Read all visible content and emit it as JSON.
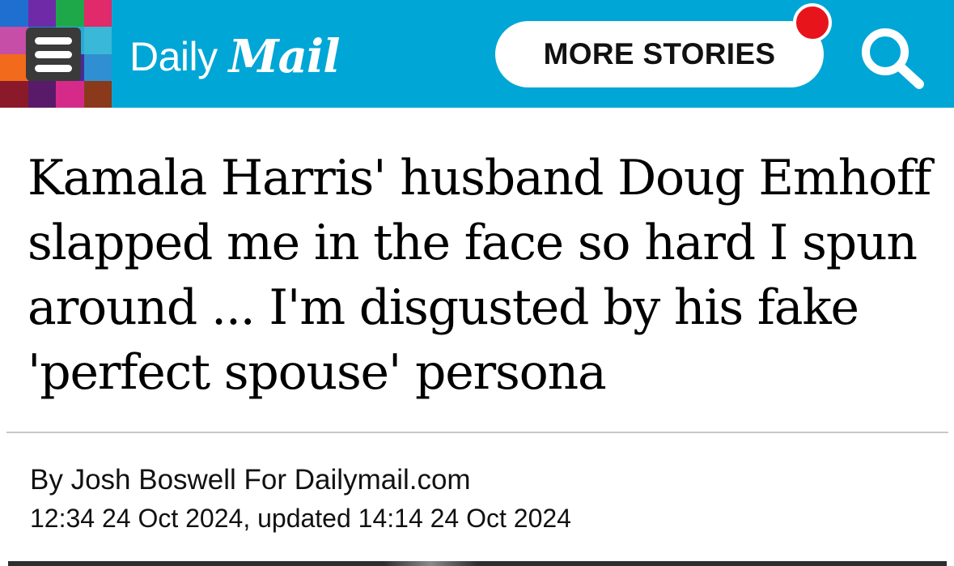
{
  "header": {
    "logo": {
      "word_1": "Daily",
      "word_2": "Mail"
    },
    "more_stories_label": "MORE STORIES",
    "notification_color": "#e8141c",
    "background_color": "#00a6d6",
    "menu_icon": "hamburger-icon",
    "search_icon": "search-icon"
  },
  "article": {
    "headline": "Kamala Harris' husband Doug Emhoff slapped me in the face so hard I spun around ... I'm disgusted by his fake 'perfect spouse' persona",
    "byline": "By Josh Boswell For Dailymail.com",
    "timestamp": "12:34 24 Oct 2024, updated 14:14 24 Oct 2024"
  }
}
